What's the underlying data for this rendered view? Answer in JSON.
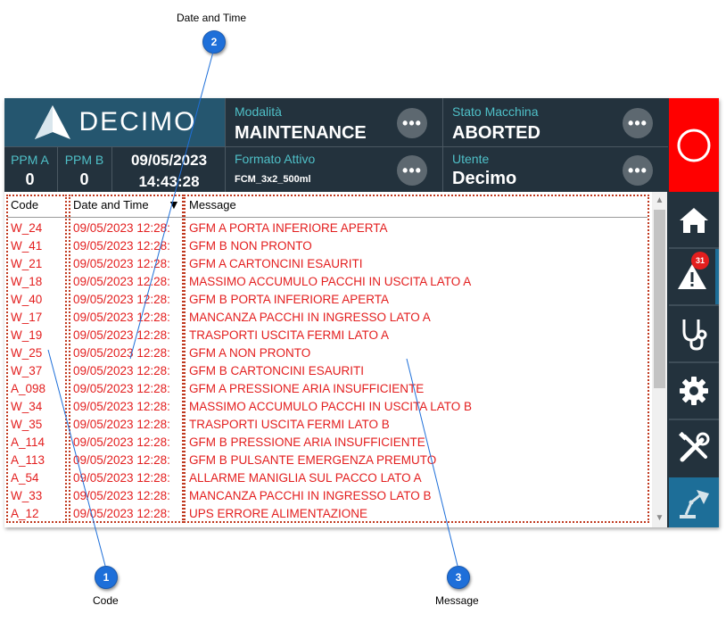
{
  "callouts": {
    "c1": {
      "number": "1",
      "label": "Code"
    },
    "c2": {
      "number": "2",
      "label": "Date and Time"
    },
    "c3": {
      "number": "3",
      "label": "Message"
    }
  },
  "header": {
    "logo_text": "DECIMO",
    "modalita": {
      "label": "Modalità",
      "value": "MAINTENANCE"
    },
    "stato": {
      "label": "Stato Macchina",
      "value": "ABORTED"
    },
    "formato": {
      "label": "Formato Attivo",
      "value": "FCM_3x2_500ml"
    },
    "utente": {
      "label": "Utente",
      "value": "Decimo"
    },
    "ppm_a": {
      "label": "PPM A",
      "value": "0"
    },
    "ppm_b": {
      "label": "PPM B",
      "value": "0"
    },
    "date": "09/05/2023",
    "time": "14:43:28",
    "dots": "•••"
  },
  "table": {
    "columns": {
      "code": "Code",
      "date": "Date and Time",
      "message": "Message"
    },
    "sort_indicator": "▼",
    "rows": [
      {
        "code": "W_24",
        "date": "09/05/2023 12:28:",
        "message": "GFM A PORTA INFERIORE APERTA"
      },
      {
        "code": "W_41",
        "date": "09/05/2023 12:28:",
        "message": "GFM B NON PRONTO"
      },
      {
        "code": "W_21",
        "date": "09/05/2023 12:28:",
        "message": "GFM A CARTONCINI ESAURITI"
      },
      {
        "code": "W_18",
        "date": "09/05/2023 12:28:",
        "message": "MASSIMO ACCUMULO PACCHI IN USCITA LATO A"
      },
      {
        "code": "W_40",
        "date": "09/05/2023 12:28:",
        "message": "GFM B PORTA INFERIORE APERTA"
      },
      {
        "code": "W_17",
        "date": "09/05/2023 12:28:",
        "message": "MANCANZA PACCHI IN INGRESSO LATO A"
      },
      {
        "code": "W_19",
        "date": "09/05/2023 12:28:",
        "message": "TRASPORTI USCITA FERMI LATO A"
      },
      {
        "code": "W_25",
        "date": "09/05/2023 12:28:",
        "message": "GFM A NON PRONTO"
      },
      {
        "code": "W_37",
        "date": "09/05/2023 12:28:",
        "message": "GFM B CARTONCINI ESAURITI"
      },
      {
        "code": "A_098",
        "date": "09/05/2023 12:28:",
        "message": "GFM A PRESSIONE ARIA INSUFFICIENTE"
      },
      {
        "code": "W_34",
        "date": "09/05/2023 12:28:",
        "message": "MASSIMO ACCUMULO PACCHI IN USCITA LATO B"
      },
      {
        "code": "W_35",
        "date": "09/05/2023 12:28:",
        "message": "TRASPORTI USCITA FERMI LATO B"
      },
      {
        "code": "A_114",
        "date": "09/05/2023 12:28:",
        "message": "GFM B PRESSIONE ARIA INSUFFICIENTE"
      },
      {
        "code": "A_113",
        "date": "09/05/2023 12:28:",
        "message": "GFM B PULSANTE EMERGENZA PREMUTO"
      },
      {
        "code": "A_54",
        "date": "09/05/2023 12:28:",
        "message": "ALLARME MANIGLIA SUL PACCO LATO A"
      },
      {
        "code": "W_33",
        "date": "09/05/2023 12:28:",
        "message": "MANCANZA PACCHI IN INGRESSO LATO B"
      },
      {
        "code": "A_12",
        "date": "09/05/2023 12:28:",
        "message": "UPS ERRORE ALIMENTAZIONE"
      }
    ]
  },
  "sidebar": {
    "alarm_count": "31",
    "items": [
      "stop-button",
      "home-icon",
      "warning-icon",
      "stethoscope-icon",
      "gear-icon",
      "tools-icon",
      "lamp-icon"
    ]
  },
  "colors": {
    "accent": "#4fc0c8",
    "panel": "#23323d",
    "alarm_text": "#e31e1e",
    "stop": "#ff0000",
    "callout": "#1e6fd9"
  }
}
